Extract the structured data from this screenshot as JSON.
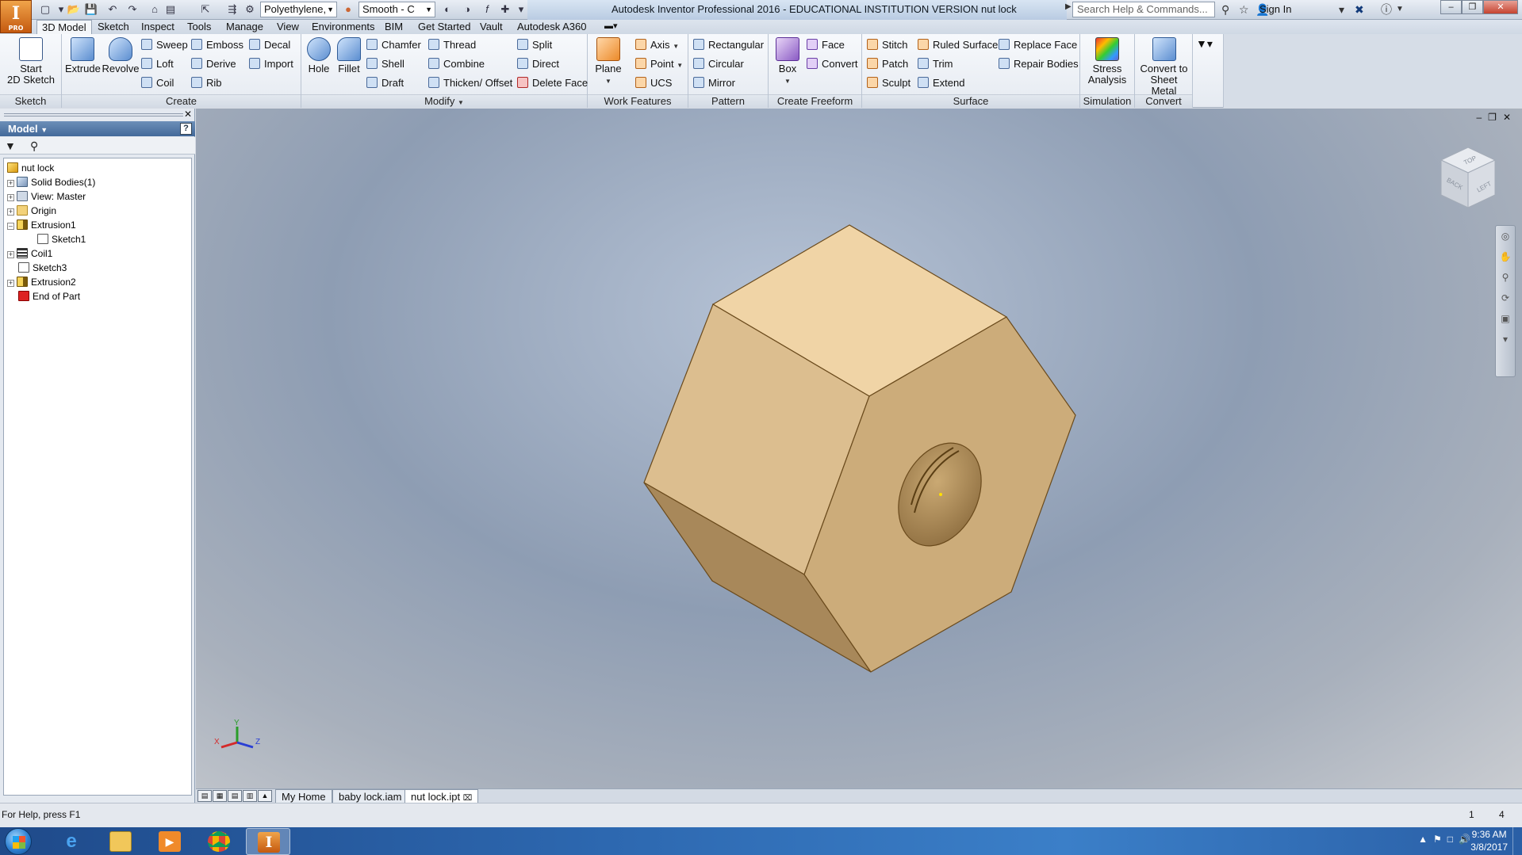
{
  "app": {
    "logo_letter": "I",
    "logo_badge": "PRO",
    "window_title": "Autodesk Inventor Professional 2016 - EDUCATIONAL INSTITUTION VERSION     nut lock",
    "material": "Polyethylene,",
    "appearance": "Smooth - C",
    "search_placeholder": "Search Help & Commands...",
    "sign_in": "Sign In"
  },
  "tabs": [
    {
      "label": "3D Model",
      "active": true
    },
    {
      "label": "Sketch"
    },
    {
      "label": "Inspect"
    },
    {
      "label": "Tools"
    },
    {
      "label": "Manage"
    },
    {
      "label": "View"
    },
    {
      "label": "Environments"
    },
    {
      "label": "BIM"
    },
    {
      "label": "Get Started"
    },
    {
      "label": "Vault"
    },
    {
      "label": "Autodesk A360"
    }
  ],
  "ribbon": {
    "sketch": {
      "title": "Sketch",
      "start_sketch": "Start\n2D Sketch"
    },
    "create": {
      "title": "Create",
      "extrude": "Extrude",
      "revolve": "Revolve",
      "sweep": "Sweep",
      "loft": "Loft",
      "coil": "Coil",
      "emboss": "Emboss",
      "derive": "Derive",
      "rib": "Rib",
      "decal": "Decal",
      "import": "Import"
    },
    "modify": {
      "title": "Modify",
      "hole": "Hole",
      "fillet": "Fillet",
      "chamfer": "Chamfer",
      "shell": "Shell",
      "draft": "Draft",
      "thread": "Thread",
      "combine": "Combine",
      "thicken": "Thicken/ Offset",
      "split": "Split",
      "direct": "Direct",
      "delete_face": "Delete Face"
    },
    "work_features": {
      "title": "Work Features",
      "plane": "Plane",
      "axis": "Axis",
      "point": "Point",
      "ucs": "UCS"
    },
    "pattern": {
      "title": "Pattern",
      "rectangular": "Rectangular",
      "circular": "Circular",
      "mirror": "Mirror"
    },
    "freeform": {
      "title": "Create Freeform",
      "box": "Box",
      "face": "Face",
      "convert": "Convert"
    },
    "surface": {
      "title": "Surface",
      "stitch": "Stitch",
      "patch": "Patch",
      "sculpt": "Sculpt",
      "ruled_surface": "Ruled Surface",
      "trim": "Trim",
      "extend": "Extend",
      "replace_face": "Replace Face",
      "repair_bodies": "Repair Bodies"
    },
    "simulation": {
      "title": "Simulation",
      "stress": "Stress\nAnalysis"
    },
    "convert": {
      "title": "Convert",
      "sheet_metal": "Convert to\nSheet Metal"
    }
  },
  "browser": {
    "header": "Model",
    "help": "?",
    "tree": [
      {
        "label": "nut lock"
      },
      {
        "label": "Solid Bodies(1)"
      },
      {
        "label": "View: Master"
      },
      {
        "label": "Origin"
      },
      {
        "label": "Extrusion1"
      },
      {
        "label": "Sketch1"
      },
      {
        "label": "Coil1"
      },
      {
        "label": "Sketch3"
      },
      {
        "label": "Extrusion2"
      },
      {
        "label": "End of Part"
      }
    ]
  },
  "viewcube": {
    "back": "BACK",
    "left": "LEFT",
    "top": "TOP"
  },
  "triad": {
    "x": "X",
    "y": "Y",
    "z": "Z"
  },
  "doc_tabs": [
    {
      "label": "My Home"
    },
    {
      "label": "baby lock.iam"
    },
    {
      "label": "nut lock.ipt",
      "active": true
    }
  ],
  "status": {
    "help_text": "For Help, press F1",
    "count_a": "1",
    "count_b": "4"
  },
  "taskbar": {
    "time": "9:36 AM",
    "date": "3/8/2017"
  },
  "colors": {
    "part_top": "#f0d4a6",
    "part_left": "#dcbe8f",
    "part_front": "#ccac7a",
    "part_dark": "#a8885a",
    "part_edge": "#6a4a1c",
    "ribbon_bg": "#f2f5f9",
    "browser_header": "#4f76a6"
  }
}
